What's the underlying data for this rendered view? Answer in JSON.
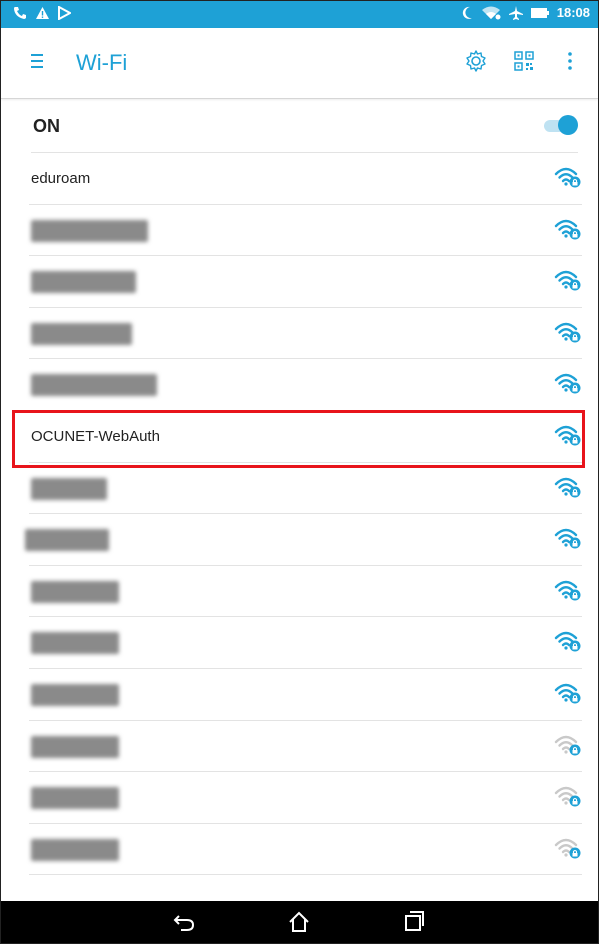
{
  "status_bar": {
    "time": "18:08",
    "left_icons": [
      "phone-icon",
      "warning-icon",
      "play-store-icon"
    ],
    "right_icons": [
      "moon-icon",
      "wifi-signal-icon",
      "airplane-icon",
      "battery-icon"
    ]
  },
  "toolbar": {
    "title": "Wi-Fi",
    "icons": [
      "menu-icon",
      "settings-icon",
      "qr-code-icon",
      "overflow-menu-icon"
    ]
  },
  "wifi_toggle": {
    "label": "ON",
    "state": "on"
  },
  "networks": [
    {
      "name": "eduroam",
      "hidden": false,
      "signal": "strong"
    },
    {
      "name": "",
      "hidden": true,
      "signal": "strong"
    },
    {
      "name": "",
      "hidden": true,
      "signal": "strong"
    },
    {
      "name": "",
      "hidden": true,
      "signal": "strong"
    },
    {
      "name": "",
      "hidden": true,
      "signal": "strong"
    },
    {
      "name": "OCUNET-WebAuth",
      "hidden": false,
      "signal": "strong",
      "highlighted": true
    },
    {
      "name": "",
      "hidden": true,
      "signal": "strong"
    },
    {
      "name": "",
      "hidden": true,
      "signal": "strong"
    },
    {
      "name": "",
      "hidden": true,
      "signal": "strong"
    },
    {
      "name": "",
      "hidden": true,
      "signal": "strong"
    },
    {
      "name": "",
      "hidden": true,
      "signal": "strong"
    },
    {
      "name": "",
      "hidden": true,
      "signal": "weak"
    },
    {
      "name": "",
      "hidden": true,
      "signal": "weak"
    },
    {
      "name": "",
      "hidden": true,
      "signal": "weak"
    }
  ],
  "colors": {
    "accent": "#1ea1d6",
    "highlight_border": "#e8141b",
    "weak_signal": "#c9c9c9"
  },
  "nav_bar": {
    "buttons": [
      "back-icon",
      "home-icon",
      "recents-icon"
    ]
  }
}
